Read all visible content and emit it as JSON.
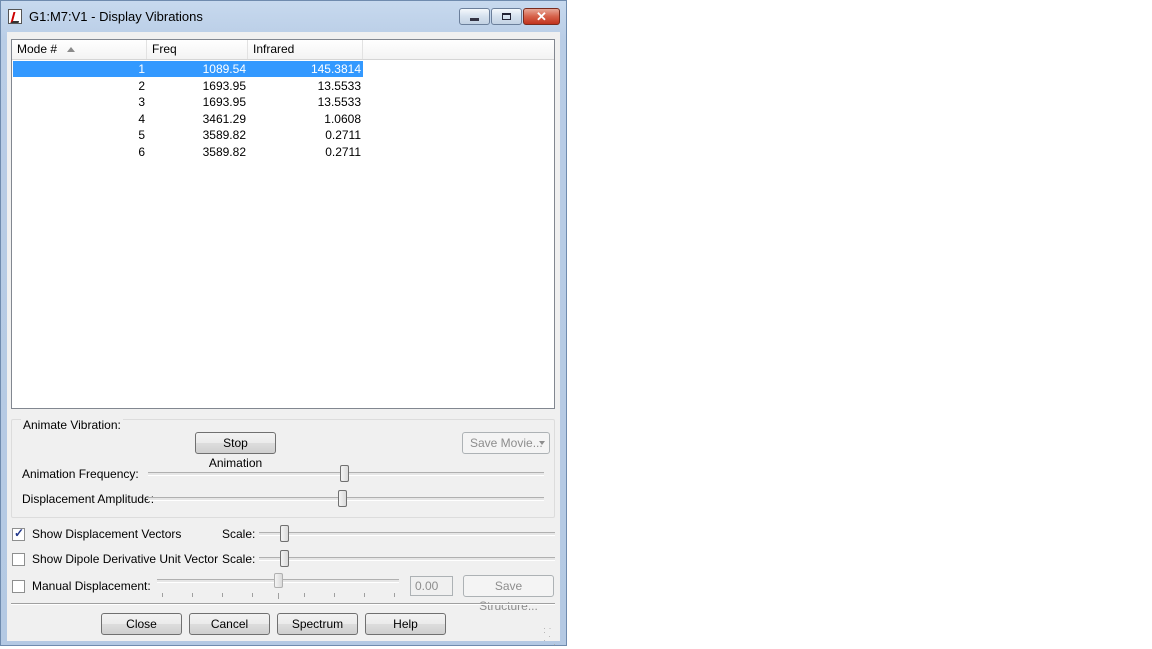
{
  "window": {
    "title": "G1:M7:V1 - Display Vibrations"
  },
  "list": {
    "columns": [
      "Mode #",
      "Freq",
      "Infrared"
    ],
    "rows": [
      {
        "mode": "1",
        "freq": "1089.54",
        "ir": "145.3814"
      },
      {
        "mode": "2",
        "freq": "1693.95",
        "ir": "13.5533"
      },
      {
        "mode": "3",
        "freq": "1693.95",
        "ir": "13.5533"
      },
      {
        "mode": "4",
        "freq": "3461.29",
        "ir": "1.0608"
      },
      {
        "mode": "5",
        "freq": "3589.82",
        "ir": "0.2711"
      },
      {
        "mode": "6",
        "freq": "3589.82",
        "ir": "0.2711"
      }
    ],
    "selected_mode": "1"
  },
  "animate": {
    "group_label": "Animate Vibration:",
    "stop_button": "Stop Animation",
    "save_movie": "Save Movie...",
    "frequency_label": "Animation Frequency:",
    "amplitude_label": "Displacement Amplitude:"
  },
  "options": {
    "show_vectors_label": "Show Displacement Vectors",
    "show_vectors_checked": true,
    "show_dipole_label": "Show Dipole Derivative Unit Vector",
    "show_dipole_checked": false,
    "scale_label": "Scale:",
    "manual_label": "Manual Displacement:",
    "manual_checked": false,
    "manual_value": "0.00",
    "save_structure": "Save Structure..."
  },
  "buttons": {
    "close": "Close",
    "cancel": "Cancel",
    "spectrum": "Spectrum",
    "help": "Help"
  },
  "colors": {
    "selection": "#3399ff",
    "close_button": "#c9452d"
  }
}
